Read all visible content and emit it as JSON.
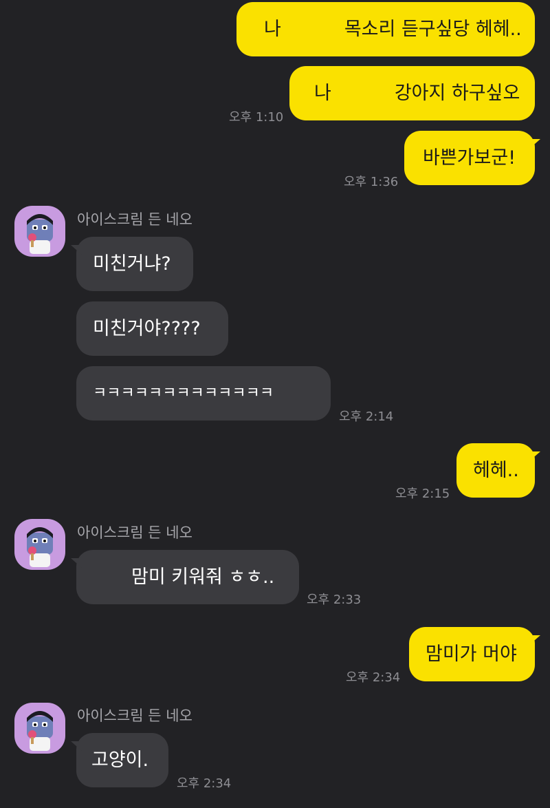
{
  "sender_name": "아이스크림 든 네오",
  "messages_me_1": {
    "part_a": "나",
    "part_b": "목소리 듣구싶당 헤헤.."
  },
  "messages_me_2": {
    "part_a": "나",
    "part_b": "강아지 하구싶오",
    "time": "오후 1:10"
  },
  "messages_me_3": {
    "text": "바쁜가보군!",
    "time": "오후 1:36"
  },
  "group_them_1": {
    "lines": [
      "미친거냐?",
      "미친거야????",
      "ㅋㅋㅋㅋㅋㅋㅋㅋㅋㅋㅋㅋㅋ"
    ],
    "time": "오후 2:14"
  },
  "messages_me_4": {
    "text": "헤헤..",
    "time": "오후 2:15"
  },
  "group_them_2": {
    "text": "맘미 키워줘 ㅎㅎ..",
    "time": "오후 2:33"
  },
  "messages_me_5": {
    "text": "맘미가 머야",
    "time": "오후 2:34"
  },
  "group_them_3": {
    "text": "고양이.",
    "time": "오후 2:34"
  },
  "colors": {
    "background": "#222225",
    "my_bubble": "#FAE100",
    "their_bubble": "#3b3b3f",
    "avatar_bg": "#c89be0"
  }
}
